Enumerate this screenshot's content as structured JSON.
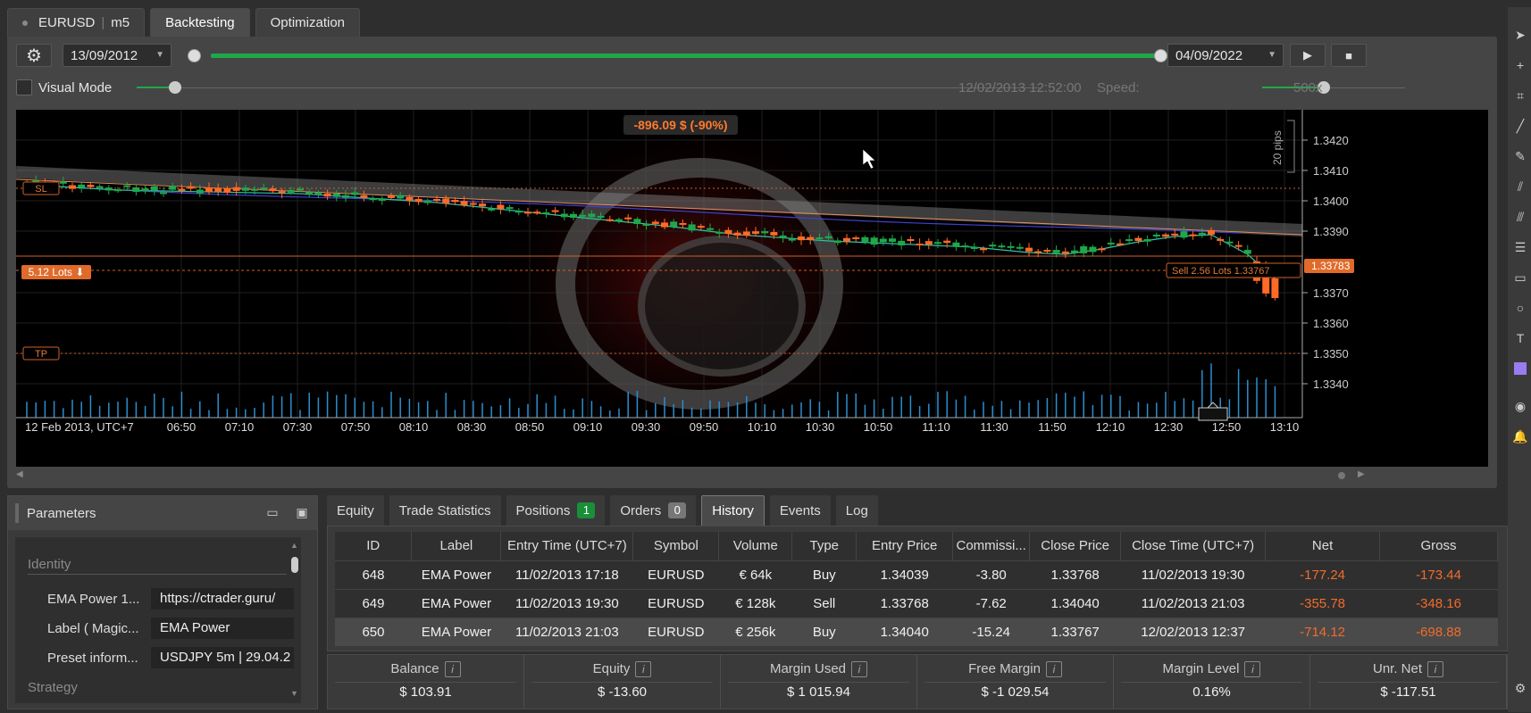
{
  "top_tabs": {
    "symbol": "EURUSD",
    "timeframe": "m5",
    "backtesting": "Backtesting",
    "optimization": "Optimization"
  },
  "controls": {
    "start_date": "13/09/2012",
    "end_date": "04/09/2022",
    "visual_mode": "Visual Mode",
    "current_time": "12/02/2013 12:52:00",
    "speed_label": "Speed:",
    "speed_value": "500x"
  },
  "chart": {
    "pnl_label": "-896.09 $ (-90%)",
    "sl_label": "SL",
    "tp_label": "TP",
    "lots_label": "5.12 Lots ⬇",
    "sell_label": "Sell 2.56 Lots 1.33767",
    "price_tag": "1.33783",
    "pips_label": "20 pips",
    "date_label": "12 Feb 2013, UTC+7",
    "y_ticks": [
      "1.3420",
      "1.3410",
      "1.3400",
      "1.3390",
      "1.3370",
      "1.3360",
      "1.3350",
      "1.3340"
    ],
    "x_ticks": [
      "06:50",
      "07:10",
      "07:30",
      "07:50",
      "08:10",
      "08:30",
      "08:50",
      "09:10",
      "09:30",
      "09:50",
      "10:10",
      "10:30",
      "10:50",
      "11:10",
      "11:30",
      "11:50",
      "12:10",
      "12:30",
      "12:50",
      "13:10"
    ],
    "colors": {
      "up": "#1fa84a",
      "down": "#ff6a26",
      "ema_fast": "#2ec4a5",
      "ema_slow": "#4040d0",
      "level": "#d0602a"
    }
  },
  "params": {
    "title": "Parameters",
    "group_identity": "Identity",
    "group_strategy": "Strategy",
    "rows": [
      {
        "name": "EMA Power 1...",
        "value": "https://ctrader.guru/"
      },
      {
        "name": "Label ( Magic...",
        "value": "EMA Power"
      },
      {
        "name": "Preset inform...",
        "value": "USDJPY 5m | 29.04.2"
      }
    ]
  },
  "bottom_tabs": {
    "equity": "Equity",
    "trade_stats": "Trade Statistics",
    "positions": "Positions",
    "positions_count": "1",
    "orders": "Orders",
    "orders_count": "0",
    "history": "History",
    "events": "Events",
    "log": "Log"
  },
  "history": {
    "headers": [
      "ID",
      "Label",
      "Entry Time (UTC+7)",
      "Symbol",
      "Volume",
      "Type",
      "Entry Price",
      "Commissi...",
      "Close Price",
      "Close Time (UTC+7)",
      "Net",
      "Gross"
    ],
    "rows": [
      [
        "648",
        "EMA Power",
        "11/02/2013 17:18",
        "EURUSD",
        "€ 64k",
        "Buy",
        "1.34039",
        "-3.80",
        "1.33768",
        "11/02/2013 19:30",
        "-177.24",
        "-173.44"
      ],
      [
        "649",
        "EMA Power",
        "11/02/2013 19:30",
        "EURUSD",
        "€ 128k",
        "Sell",
        "1.33768",
        "-7.62",
        "1.34040",
        "11/02/2013 21:03",
        "-355.78",
        "-348.16"
      ],
      [
        "650",
        "EMA Power",
        "11/02/2013 21:03",
        "EURUSD",
        "€ 256k",
        "Buy",
        "1.34040",
        "-15.24",
        "1.33767",
        "12/02/2013 12:37",
        "-714.12",
        "-698.88"
      ]
    ]
  },
  "summary": {
    "balance_label": "Balance",
    "balance": "$ 103.91",
    "equity_label": "Equity",
    "equity": "$ -13.60",
    "margin_used_label": "Margin Used",
    "margin_used": "$ 1 015.94",
    "free_margin_label": "Free Margin",
    "free_margin": "$ -1 029.54",
    "margin_level_label": "Margin Level",
    "margin_level": "0.16%",
    "unr_net_label": "Unr. Net",
    "unr_net": "$ -117.51"
  }
}
